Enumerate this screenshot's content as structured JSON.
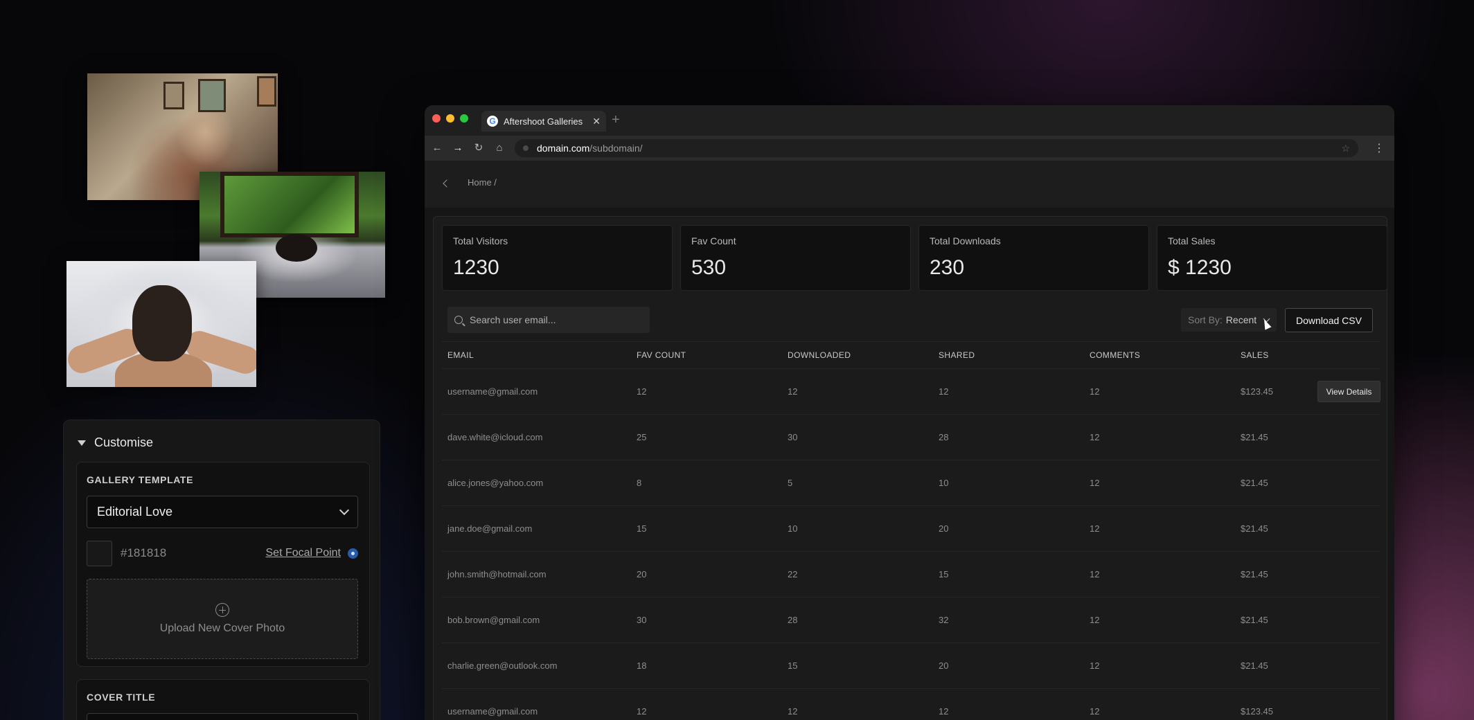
{
  "customise": {
    "title": "Customise",
    "gallery_template_label": "GALLERY TEMPLATE",
    "template_value": "Editorial Love",
    "color_hex": "#181818",
    "focal_point_label": "Set Focal Point",
    "upload_label": "Upload  New Cover Photo",
    "cover_title_label": "COVER TITLE"
  },
  "browser": {
    "tab_title": "Aftershoot Galleries",
    "tab_favicon": "G",
    "url_domain": "domain.com",
    "url_path": "/subdomain/"
  },
  "page": {
    "breadcrumb": "Home /"
  },
  "stats": [
    {
      "label": "Total Visitors",
      "value": "1230"
    },
    {
      "label": "Fav Count",
      "value": "530"
    },
    {
      "label": "Total Downloads",
      "value": "230"
    },
    {
      "label": "Total Sales",
      "value": "$ 1230"
    }
  ],
  "toolbar": {
    "search_placeholder": "Search user email...",
    "sort_label": "Sort By:",
    "sort_value": "Recent",
    "download_label": "Download CSV"
  },
  "table": {
    "headers": [
      "EMAIL",
      "FAV COUNT",
      "DOWNLOADED",
      "SHARED",
      "COMMENTS",
      "SALES"
    ],
    "view_details_label": "View Details",
    "rows": [
      [
        "username@gmail.com",
        "12",
        "12",
        "12",
        "12",
        "$123.45"
      ],
      [
        "dave.white@icloud.com",
        "25",
        "30",
        "28",
        "12",
        "$21.45"
      ],
      [
        "alice.jones@yahoo.com",
        "8",
        "5",
        "10",
        "12",
        "$21.45"
      ],
      [
        "jane.doe@gmail.com",
        "15",
        "10",
        "20",
        "12",
        "$21.45"
      ],
      [
        "john.smith@hotmail.com",
        "20",
        "22",
        "15",
        "12",
        "$21.45"
      ],
      [
        "bob.brown@gmail.com",
        "30",
        "28",
        "32",
        "12",
        "$21.45"
      ],
      [
        "charlie.green@outlook.com",
        "18",
        "15",
        "20",
        "12",
        "$21.45"
      ],
      [
        "username@gmail.com",
        "12",
        "12",
        "12",
        "12",
        "$123.45"
      ]
    ]
  }
}
